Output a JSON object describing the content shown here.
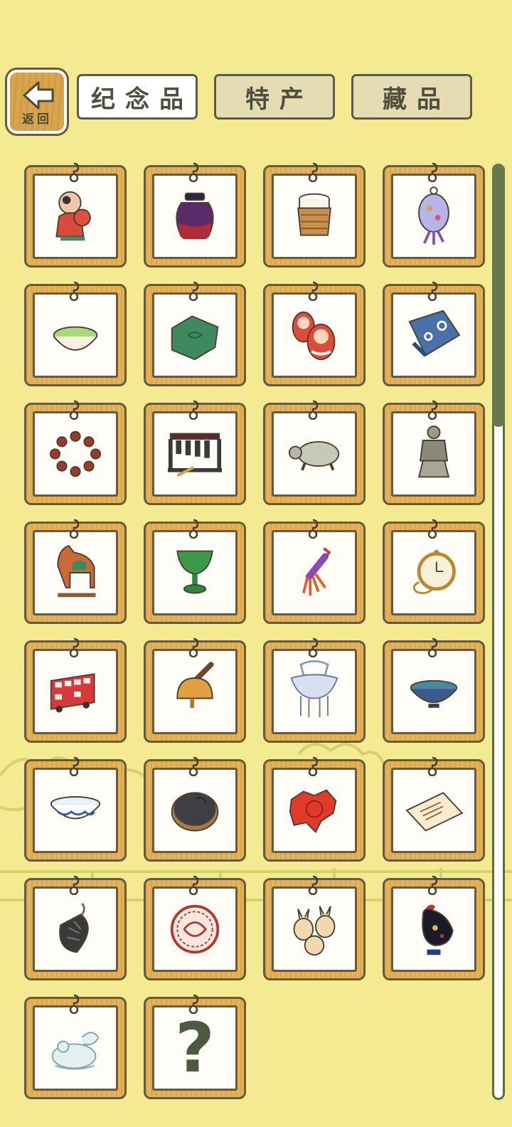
{
  "header": {
    "back_label": "返回",
    "tabs": [
      {
        "label": "纪念品",
        "active": true
      },
      {
        "label": "特产",
        "active": false
      },
      {
        "label": "藏品",
        "active": false
      }
    ]
  },
  "items": [
    {
      "name": "doll-figurine-icon"
    },
    {
      "name": "pottery-jar-icon"
    },
    {
      "name": "wicker-cup-icon"
    },
    {
      "name": "cloisonne-pendant-icon"
    },
    {
      "name": "matcha-bowl-icon"
    },
    {
      "name": "jade-seal-icon"
    },
    {
      "name": "matryoshka-icon"
    },
    {
      "name": "scarf-icon"
    },
    {
      "name": "prayer-beads-icon"
    },
    {
      "name": "chime-bells-icon"
    },
    {
      "name": "stone-turtle-icon"
    },
    {
      "name": "terracotta-warrior-icon"
    },
    {
      "name": "tang-horse-icon"
    },
    {
      "name": "jade-cup-icon"
    },
    {
      "name": "tassel-knot-icon"
    },
    {
      "name": "pocket-watch-icon"
    },
    {
      "name": "double-decker-bus-icon"
    },
    {
      "name": "hand-bell-icon"
    },
    {
      "name": "silver-lock-icon"
    },
    {
      "name": "tea-bowl-icon"
    },
    {
      "name": "porcelain-bowl-icon"
    },
    {
      "name": "inkstone-icon"
    },
    {
      "name": "red-umbrella-icon"
    },
    {
      "name": "document-icon"
    },
    {
      "name": "pinecone-pendant-icon"
    },
    {
      "name": "paper-cut-icon"
    },
    {
      "name": "rabbit-figurines-icon"
    },
    {
      "name": "barcelos-rooster-icon"
    },
    {
      "name": "jade-frog-icon"
    },
    {
      "name": "unknown-item",
      "label": "?"
    }
  ],
  "colors": {
    "background": "#f3ea92",
    "card_frame": "#e4b257",
    "outline": "#6a5a3c",
    "scroll_thumb": "#68774f"
  }
}
